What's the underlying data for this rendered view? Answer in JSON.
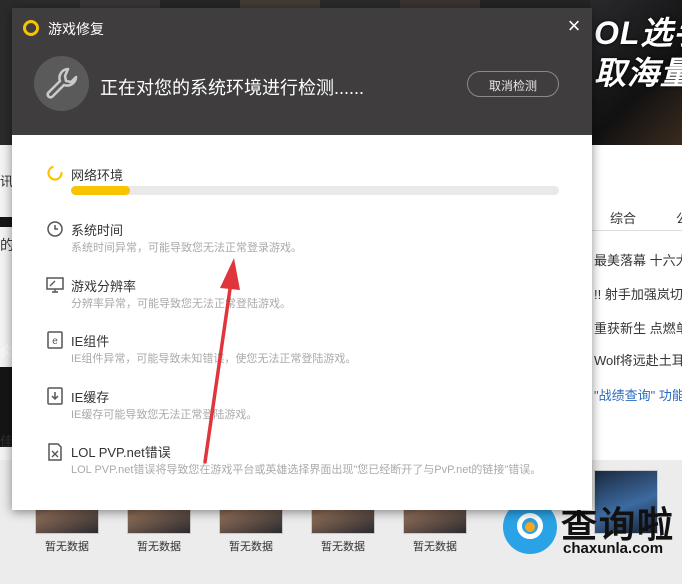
{
  "background": {
    "banner_lines": [
      "OL选手",
      "取海量"
    ],
    "left_glyphs": [
      "讯",
      "的",
      "炎",
      "佳"
    ],
    "tabs": [
      "综合",
      "公"
    ],
    "news": [
      "最美落幕 十六大到",
      "!! 射手加强岚切",
      "重获新生 点燃单",
      "Wolf将远赴土耳",
      "\"战绩查询\" 功能"
    ],
    "no_data_labels": [
      "暂无数据",
      "暂无数据",
      "暂无数据",
      "暂无数据",
      "暂无数据"
    ],
    "watermark": {
      "cn": "查询啦",
      "en": "chaxunla.com"
    }
  },
  "dialog": {
    "title": "游戏修复",
    "close_icon": "×",
    "status": "正在对您的系统环境进行检测......",
    "cancel_label": "取消检测",
    "checking": {
      "icon": "loading-spinner-icon",
      "title": "网络环境",
      "progress": 0.12
    },
    "items": [
      {
        "icon": "clock-icon",
        "title": "系统时间",
        "desc": "系统时间异常，可能导致您无法正常登录游戏。"
      },
      {
        "icon": "monitor-icon",
        "title": "游戏分辨率",
        "desc": "分辨率异常，可能导致您无法正常登陆游戏。"
      },
      {
        "icon": "ie-icon",
        "title": "IE组件",
        "desc": "IE组件异常，可能导致未知错误，使您无法正常登陆游戏。"
      },
      {
        "icon": "download-icon",
        "title": "IE缓存",
        "desc": "IE缓存可能导致您无法正常登陆游戏。"
      },
      {
        "icon": "error-file-icon",
        "title": "LOL PVP.net错误",
        "desc": "LOL PVP.net错误将导致您在游戏平台或英雄选择界面出现\"您已经断开了与PvP.net的链接\"错误。"
      }
    ]
  },
  "colors": {
    "header_bg": "#3f3d3e",
    "progress": "#f8c400",
    "arrow": "#e0363b",
    "watermark_blue": "#2aa3e6"
  }
}
